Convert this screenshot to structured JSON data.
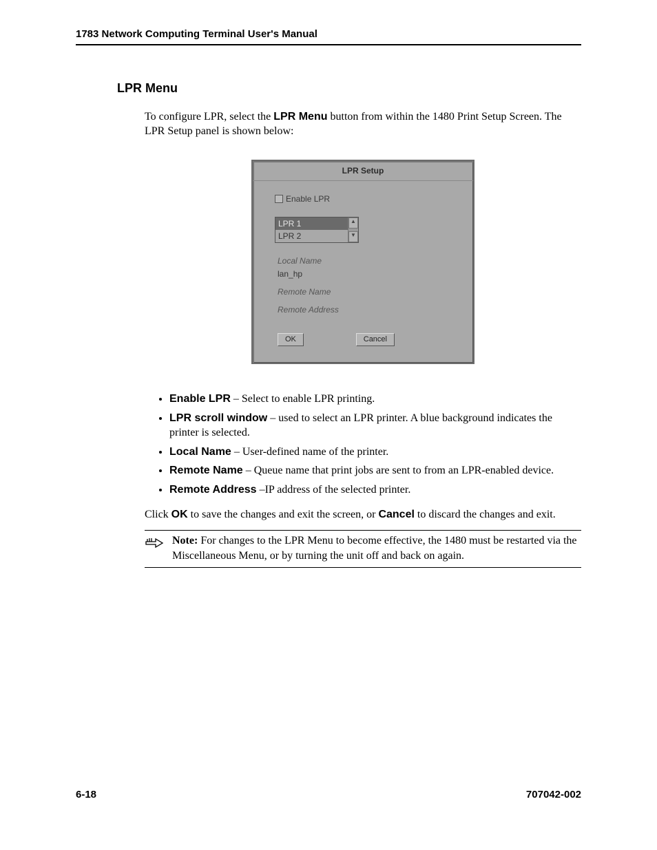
{
  "header": {
    "title": "1783 Network Computing Terminal User's Manual"
  },
  "section": {
    "title": "LPR Menu"
  },
  "intro": {
    "pre": "To configure LPR, select the ",
    "bold": "LPR Menu",
    "post": " button from within the 1480 Print Setup Screen. The LPR Setup panel is shown below:"
  },
  "dialog": {
    "title": "LPR Setup",
    "enable_label": "Enable LPR",
    "list": {
      "items": [
        "LPR 1",
        "LPR 2"
      ],
      "selected_index": 0
    },
    "fields": {
      "local_name_label": "Local Name",
      "local_name_value": "lan_hp",
      "remote_name_label": "Remote Name",
      "remote_name_value": "",
      "remote_address_label": "Remote Address",
      "remote_address_value": ""
    },
    "buttons": {
      "ok": "OK",
      "cancel": "Cancel"
    }
  },
  "bullets": [
    {
      "term": "Enable LPR",
      "desc": " – Select to enable LPR printing."
    },
    {
      "term": "LPR scroll window",
      "desc": " – used to select an LPR printer. A blue background indicates the printer is selected."
    },
    {
      "term": "Local Name",
      "desc": " – User-defined name of the printer."
    },
    {
      "term": "Remote Name",
      "desc": " – Queue name that print jobs are sent to from an LPR-enabled device."
    },
    {
      "term": "Remote Address",
      "desc": " –IP address of the selected printer."
    }
  ],
  "closing": {
    "pre": "Click ",
    "ok": "OK",
    "mid": " to save the changes and exit the screen, or ",
    "cancel": "Cancel",
    "post": " to discard the changes and exit."
  },
  "note": {
    "label": "Note:",
    "text": " For changes to the LPR Menu to become effective, the 1480 must be restarted via the Miscellaneous Menu, or by turning the unit off and back on again."
  },
  "footer": {
    "page": "6-18",
    "docnum": "707042-002"
  }
}
